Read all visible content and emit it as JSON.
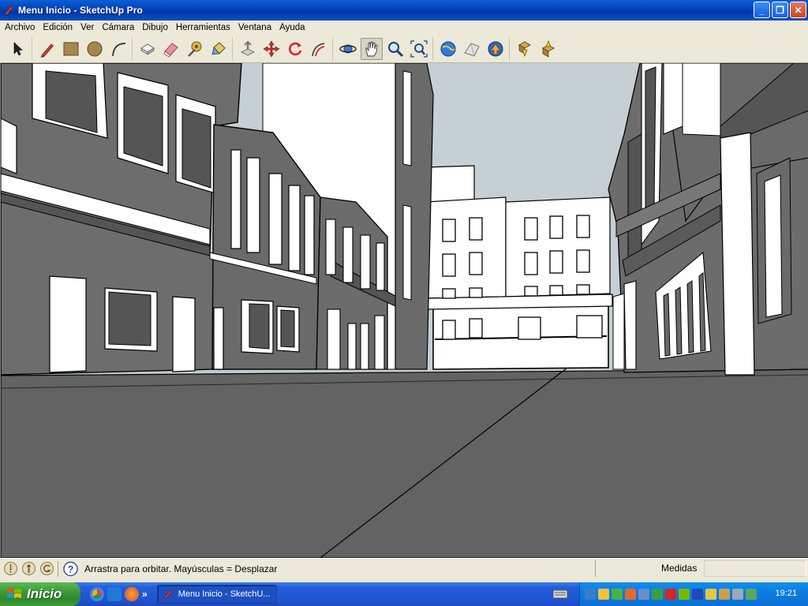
{
  "window": {
    "title": "Menu Inicio - SketchUp Pro",
    "buttons": {
      "minimize": "_",
      "maximize": "❐",
      "close": "✕"
    }
  },
  "menu": [
    "Archivo",
    "Edición",
    "Ver",
    "Cámara",
    "Dibujo",
    "Herramientas",
    "Ventana",
    "Ayuda"
  ],
  "toolbar": {
    "groups": [
      [
        {
          "icon": "select-arrow-icon"
        }
      ],
      [
        {
          "icon": "pencil-line-icon"
        },
        {
          "icon": "rectangle-icon"
        },
        {
          "icon": "circle-icon"
        },
        {
          "icon": "arc-icon"
        }
      ],
      [
        {
          "icon": "make-component-icon"
        },
        {
          "icon": "eraser-icon"
        },
        {
          "icon": "tape-measure-icon"
        },
        {
          "icon": "paint-bucket-icon"
        }
      ],
      [
        {
          "icon": "push-pull-icon"
        },
        {
          "icon": "move-icon"
        },
        {
          "icon": "rotate-icon"
        },
        {
          "icon": "offset-icon"
        }
      ],
      [
        {
          "icon": "orbit-icon"
        },
        {
          "icon": "pan-icon",
          "active": true
        },
        {
          "icon": "zoom-icon"
        },
        {
          "icon": "zoom-extents-icon"
        }
      ],
      [
        {
          "icon": "3d-warehouse-get-icon"
        },
        {
          "icon": "share-model-icon"
        },
        {
          "icon": "google-earth-icon"
        }
      ],
      [
        {
          "icon": "get-components-icon"
        },
        {
          "icon": "share-component-icon"
        }
      ]
    ]
  },
  "status": {
    "message": "Arrastra para orbitar.  Mayúsculas = Desplazar",
    "measures_label": "Medidas",
    "measures_value": ""
  },
  "taskbar": {
    "start_label": "Inicio",
    "chevron": "»",
    "task_label": "Menu Inicio - SketchU...",
    "clock": "19:21"
  },
  "colors": {
    "ground": "#636363",
    "sky": "#c2ccd1",
    "facade_dark": "#5e5e5e",
    "facade_mid": "#777777",
    "facade_light": "#ffffff"
  }
}
